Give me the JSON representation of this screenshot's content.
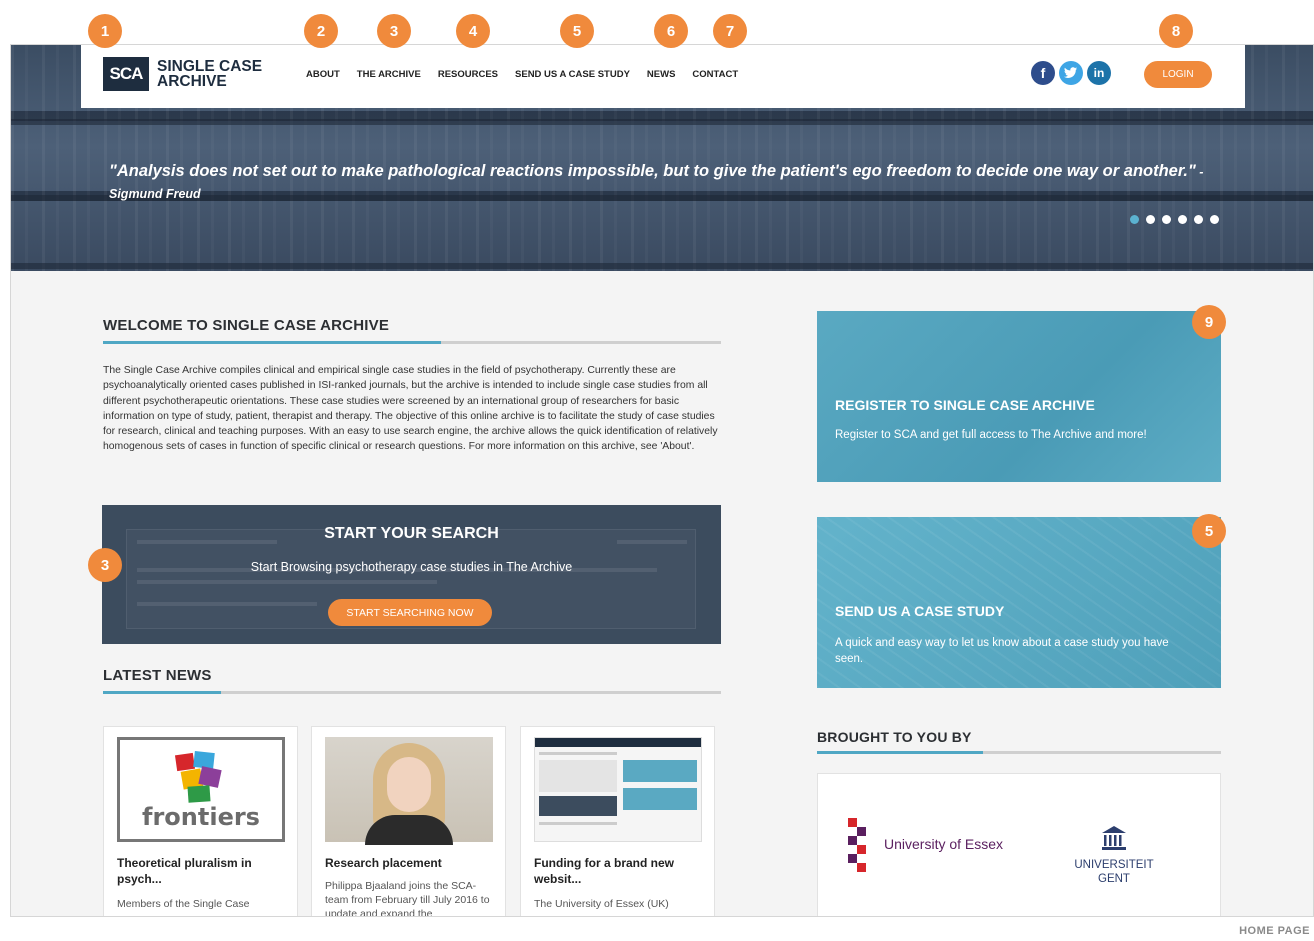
{
  "brand": {
    "logo_mark": "SCA",
    "name_line1": "SINGLE CASE",
    "name_line2": "ARCHIVE"
  },
  "nav": {
    "items": [
      {
        "label": "ABOUT"
      },
      {
        "label": "THE ARCHIVE"
      },
      {
        "label": "RESOURCES"
      },
      {
        "label": "SEND US A CASE STUDY"
      },
      {
        "label": "NEWS"
      },
      {
        "label": "CONTACT"
      }
    ],
    "social": [
      {
        "icon": "facebook-icon",
        "glyph": "f"
      },
      {
        "icon": "twitter-icon",
        "glyph": "t"
      },
      {
        "icon": "linkedin-icon",
        "glyph": "in"
      }
    ],
    "login_label": "LOGIN"
  },
  "hero": {
    "quote": "\"Analysis does not set out to make pathological reactions impossible, but to give the patient's ego freedom to decide one way or another.\"",
    "author": " - Sigmund Freud",
    "slides_total": 6,
    "active_slide": 1
  },
  "welcome": {
    "title": "WELCOME TO SINGLE CASE ARCHIVE",
    "body": "The Single Case Archive compiles clinical and empirical single case studies in the field of psychotherapy. Currently these are psychoanalytically oriented cases published in ISI-ranked journals, but the archive is intended to include single case studies from all different psychotherapeutic orientations. These case studies were screened by an international group of researchers for basic information on type of study, patient, therapist and therapy. The objective of this online archive is to facilitate the study of case studies for research, clinical and teaching purposes. With an easy to use search engine, the archive allows the quick identification of relatively homogenous sets of cases in function of specific clinical or research questions. For more information on this archive, see 'About'."
  },
  "search_promo": {
    "title": "START YOUR SEARCH",
    "subtitle": "Start Browsing psychotherapy case studies in The Archive",
    "button": "START SEARCHING NOW"
  },
  "latest_news": {
    "title": "LATEST NEWS",
    "items": [
      {
        "title": "Theoretical pluralism in psych...",
        "body": "Members of the Single Case",
        "image": "frontiers",
        "image_text": "frontiers"
      },
      {
        "title": "Research placement",
        "body": "Philippa Bjaaland joins the SCA-team from February till July 2016 to update and expand the",
        "image": "person-photo"
      },
      {
        "title": "Funding for a brand new websit...",
        "body": "The University of Essex (UK)",
        "image": "website-screenshot"
      }
    ]
  },
  "register_promo": {
    "title": "REGISTER TO SINGLE CASE ARCHIVE",
    "text": "Register to SCA and get full access to The Archive and more!"
  },
  "send_promo": {
    "title": "SEND US A CASE STUDY",
    "text": "A quick and easy way to let us know about a case study you have seen."
  },
  "partners": {
    "title": "BROUGHT TO YOU BY",
    "essex": "University of Essex",
    "gent_line1": "UNIVERSITEIT",
    "gent_line2": "GENT"
  },
  "badges": [
    "1",
    "2",
    "3",
    "4",
    "5",
    "6",
    "7",
    "8",
    "3",
    "9",
    "5"
  ],
  "caption": "HOME PAGE",
  "colors": {
    "accent": "#f08a3c",
    "brand_dark": "#1e2d3f",
    "teal": "#4fa7c4"
  }
}
